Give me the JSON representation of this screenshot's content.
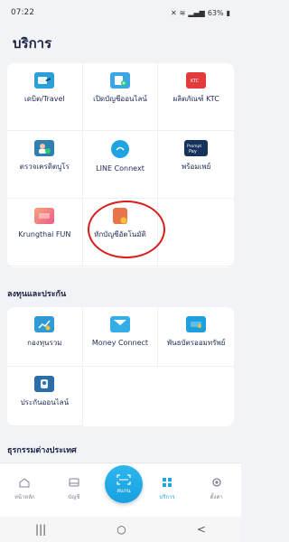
{
  "status_bar": {
    "time": "07:22",
    "battery": "63%"
  },
  "page": {
    "title": "บริการ"
  },
  "services": [
    {
      "label": "เดบิต/Travel",
      "icon": "debit-travel-icon",
      "color": "#2b9fd8"
    },
    {
      "label": "เปิดบัญชีออนไลน์",
      "icon": "open-account-icon",
      "color": "#3aa6e6"
    },
    {
      "label": "ผลิตภัณฑ์ KTC",
      "icon": "ktc-card-icon",
      "color": "#e33b3b"
    },
    {
      "label": "ตรวจเครดิตบูโร",
      "icon": "credit-bureau-icon",
      "color": "#2f7fb3"
    },
    {
      "label": "LINE Connext",
      "icon": "line-connext-icon",
      "color": "#1fa3e2"
    },
    {
      "label": "พร้อมเพย์",
      "icon": "promptpay-icon",
      "color": "#16335e"
    },
    {
      "label": "Krungthai FUN",
      "icon": "krungthai-fun-icon",
      "color": "#f06b74"
    },
    {
      "label": "หักบัญชีอัตโนมัติ",
      "icon": "auto-debit-icon",
      "color": "#e8744a"
    }
  ],
  "investment": {
    "title": "ลงทุนและประกัน",
    "items": [
      {
        "label": "กองทุนรวม",
        "icon": "mutual-fund-icon",
        "color": "#2f9ad6"
      },
      {
        "label": "Money Connect",
        "icon": "money-connect-icon",
        "color": "#35aee8"
      },
      {
        "label": "พันธบัตรออมทรัพย์",
        "icon": "savings-bond-icon",
        "color": "#1ea0de"
      },
      {
        "label": "ประกันออนไลน์",
        "icon": "online-insurance-icon",
        "color": "#2a6ea8"
      }
    ]
  },
  "foreign": {
    "title": "ธุรกรรมต่างประเทศ"
  },
  "bottom_nav": {
    "home": "หน้าหลัก",
    "accounts": "บัญชี",
    "scan": "สแกน",
    "services": "บริการ",
    "settings": "ตั้งค่า"
  },
  "system_nav": {
    "recents": "|||",
    "home": "○",
    "back": "<"
  }
}
